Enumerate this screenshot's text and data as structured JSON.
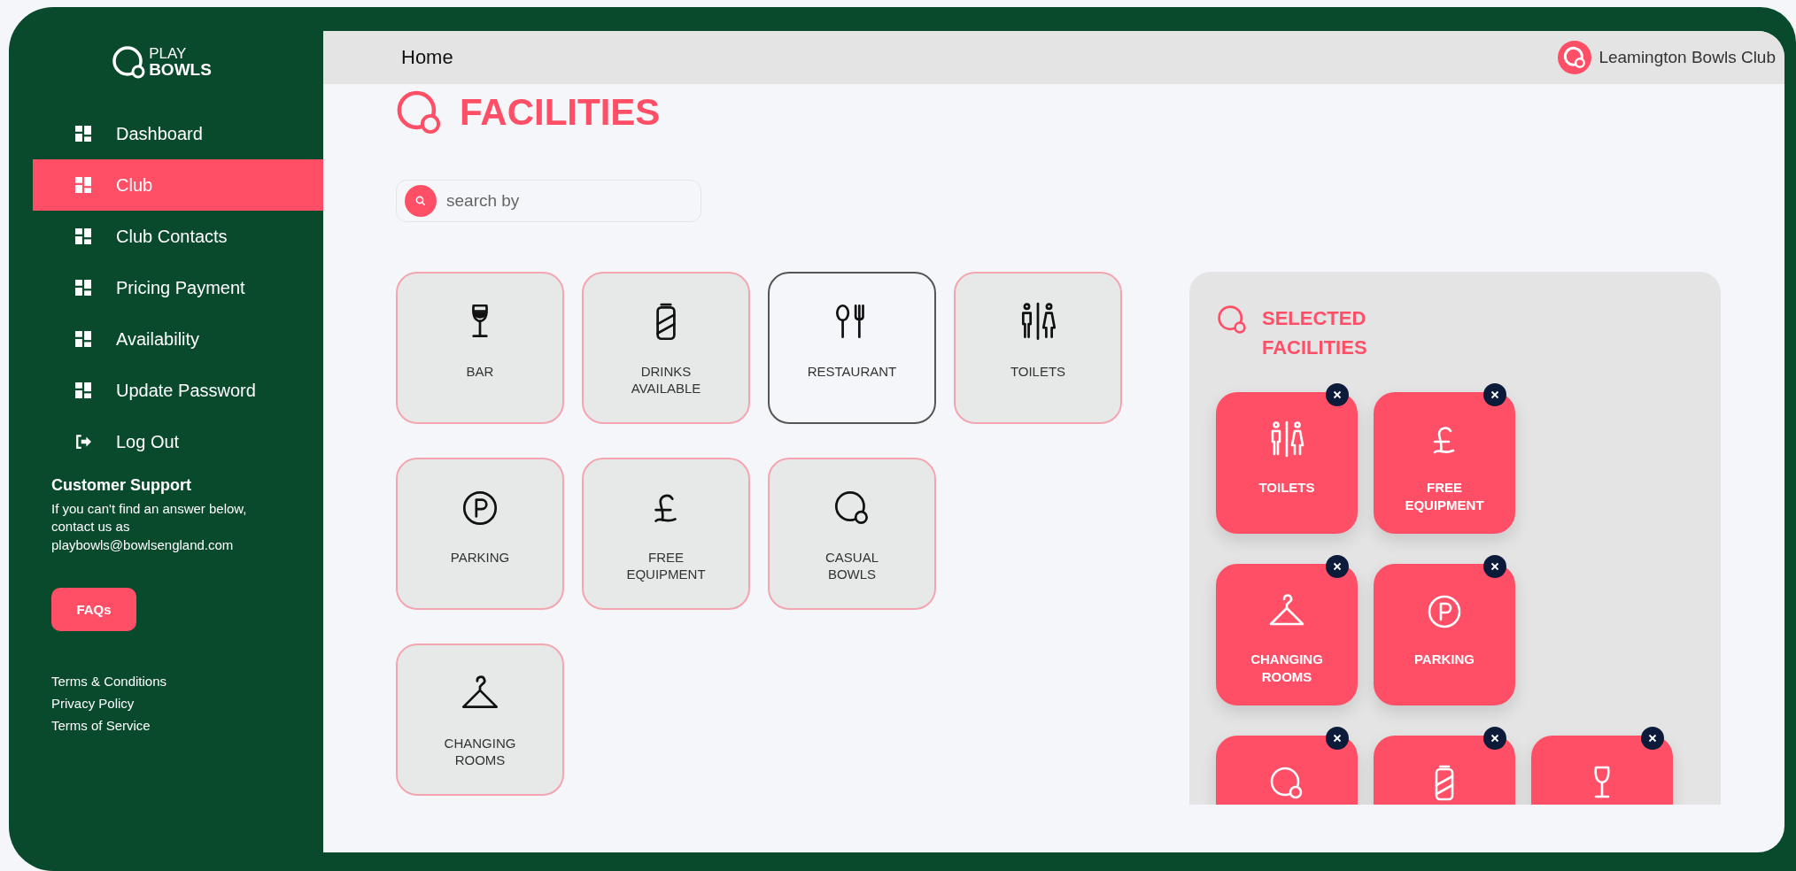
{
  "logo": {
    "line1": "PLAY",
    "line2": "BOWLS"
  },
  "sidebar": {
    "items": [
      {
        "label": "Dashboard",
        "kind": "grid",
        "selected": false
      },
      {
        "label": "Club",
        "kind": "grid",
        "selected": true
      },
      {
        "label": "Club Contacts",
        "kind": "grid",
        "selected": false
      },
      {
        "label": "Pricing Payment",
        "kind": "grid",
        "selected": false
      },
      {
        "label": "Availability",
        "kind": "grid",
        "selected": false
      },
      {
        "label": "Update Password",
        "kind": "grid",
        "selected": false
      },
      {
        "label": "Log Out",
        "kind": "logout",
        "selected": false
      }
    ],
    "support": {
      "title": "Customer Support",
      "text": "If you can't find an answer below, contact us as playbowls@bowlsengland.com",
      "button": "FAQs"
    },
    "links": [
      "Terms & Conditions",
      "Privacy Policy",
      "Terms of Service"
    ]
  },
  "header": {
    "breadcrumb": "Home",
    "club": "Leamington Bowls Club"
  },
  "page_title": "FACILITIES",
  "search": {
    "placeholder": "search by"
  },
  "facilities": [
    {
      "items": [
        {
          "label": "BAR",
          "kind": "wine",
          "selected": true
        },
        {
          "label": "DRINKS AVAILABLE",
          "kind": "can",
          "selected": true
        },
        {
          "label": "RESTAURANT",
          "kind": "cutlery",
          "selected": false
        },
        {
          "label": "TOILETS",
          "kind": "toilets",
          "selected": true
        }
      ]
    },
    {
      "items": [
        {
          "label": "PARKING",
          "kind": "parking",
          "selected": true
        },
        {
          "label": "FREE EQUIPMENT",
          "kind": "pound",
          "selected": true
        },
        {
          "label": "CASUAL BOWLS",
          "kind": "bowls",
          "selected": true
        }
      ]
    },
    {
      "items": [
        {
          "label": "CHANGING ROOMS",
          "kind": "hanger",
          "selected": true
        }
      ]
    }
  ],
  "selected_panel": {
    "title": "SELECTED FACILITIES",
    "rows": [
      {
        "items": [
          {
            "label": "TOILETS",
            "kind": "toilets"
          },
          {
            "label": "FREE EQUIPMENT",
            "kind": "pound"
          }
        ]
      },
      {
        "items": [
          {
            "label": "CHANGING ROOMS",
            "kind": "hanger"
          },
          {
            "label": "PARKING",
            "kind": "parking"
          }
        ]
      },
      {
        "items": [
          {
            "kind": "bowls"
          },
          {
            "kind": "can"
          },
          {
            "kind": "wine"
          }
        ]
      }
    ]
  }
}
